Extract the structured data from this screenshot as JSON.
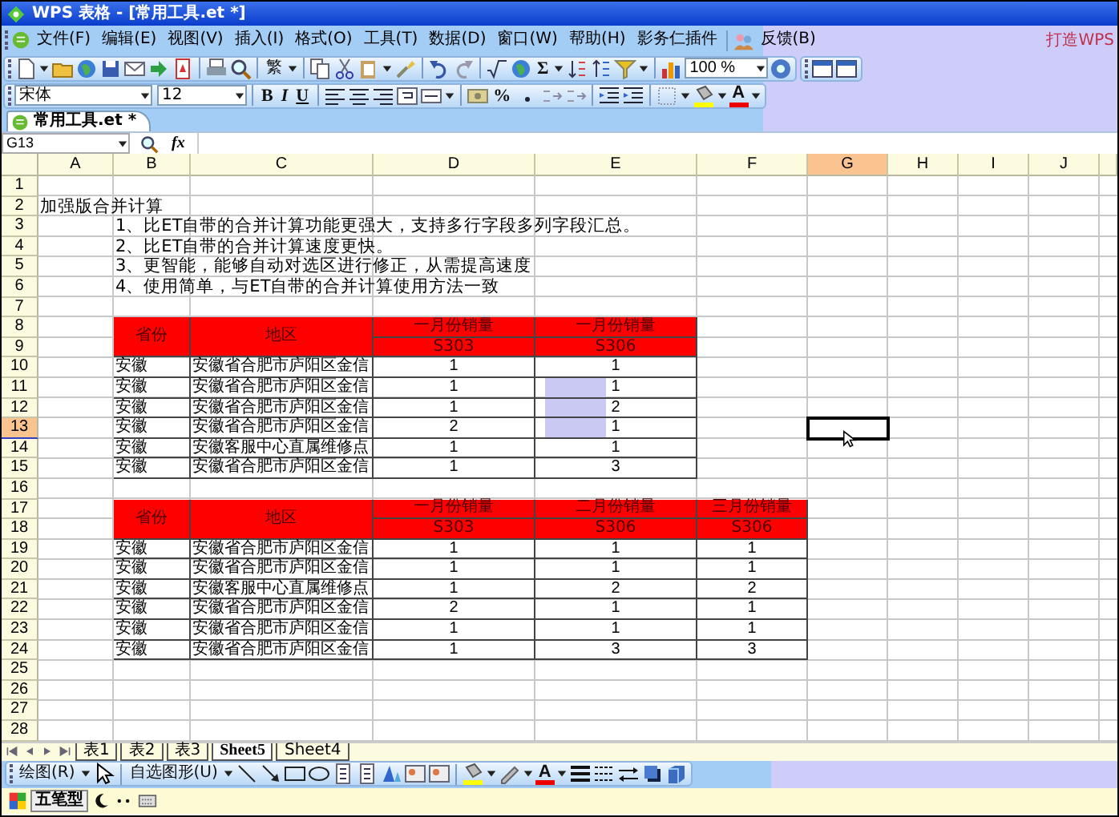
{
  "window": {
    "title": "WPS 表格 - [常用工具.et *]",
    "banner": "打造WPS"
  },
  "menu": [
    "文件(F)",
    "编辑(E)",
    "视图(V)",
    "插入(I)",
    "格式(O)",
    "工具(T)",
    "数据(D)",
    "窗口(W)",
    "帮助(H)",
    "影务仁插件",
    "反馈(B)"
  ],
  "standard_toolbar": {
    "traditional": "繁",
    "sum": "Σ",
    "zoom": "100 %"
  },
  "format_toolbar": {
    "font": "宋体",
    "size": "12",
    "bold": "B",
    "italic": "I",
    "underline": "U",
    "percent": "%",
    "font_color": "A"
  },
  "document_tabs": [
    {
      "label": "常用工具.et *",
      "selected": true
    }
  ],
  "formula_bar": {
    "name_box": "G13",
    "function_label": "fx"
  },
  "columns": [
    {
      "label": "A",
      "selected": false
    },
    {
      "label": "B",
      "selected": false
    },
    {
      "label": "C",
      "selected": false
    },
    {
      "label": "D",
      "selected": false
    },
    {
      "label": "E",
      "selected": false
    },
    {
      "label": "F",
      "selected": false
    },
    {
      "label": "G",
      "selected": true
    },
    {
      "label": "H",
      "selected": false
    },
    {
      "label": "I",
      "selected": false
    },
    {
      "label": "J",
      "selected": false
    }
  ],
  "rows": [
    {
      "header": "1",
      "selected": false
    },
    {
      "header": "2",
      "selected": false,
      "cells": [
        {
          "text": "加强版合并计算",
          "kind": "note"
        }
      ]
    },
    {
      "header": "3",
      "selected": false,
      "cells": [
        null,
        {
          "text": "1、比ET自带的合并计算功能更强大，支持多行字段多列字段汇总。",
          "kind": "note"
        }
      ]
    },
    {
      "header": "4",
      "selected": false,
      "cells": [
        null,
        {
          "text": "2、比ET自带的合并计算速度更快。",
          "kind": "note"
        }
      ]
    },
    {
      "header": "5",
      "selected": false,
      "cells": [
        null,
        {
          "text": "3、更智能，能够自动对选区进行修正，从需提高速度",
          "kind": "note"
        }
      ]
    },
    {
      "header": "6",
      "selected": false,
      "cells": [
        null,
        {
          "text": "4、使用简单，与ET自带的合并计算使用方法一致",
          "kind": "note"
        }
      ]
    },
    {
      "header": "7",
      "selected": false
    },
    {
      "header": "8",
      "selected": false,
      "cells": [
        null,
        {
          "text": "省份",
          "kind": "head",
          "merged_down": true
        },
        {
          "text": "地区",
          "kind": "head",
          "merged_down": true
        },
        {
          "text": "一月份销量",
          "kind": "head"
        },
        {
          "text": "一月份销量",
          "kind": "head"
        }
      ]
    },
    {
      "header": "9",
      "selected": false,
      "cells": [
        null,
        null,
        null,
        {
          "text": "S303",
          "kind": "head"
        },
        {
          "text": "S306",
          "kind": "head"
        }
      ]
    },
    {
      "header": "10",
      "selected": false,
      "cells": [
        null,
        {
          "text": "安徽",
          "kind": "text"
        },
        {
          "text": "安徽省合肥市庐阳区金信",
          "kind": "text"
        },
        {
          "text": "1",
          "kind": "number"
        },
        {
          "text": "1",
          "kind": "number"
        }
      ]
    },
    {
      "header": "11",
      "selected": false,
      "cells": [
        null,
        {
          "text": "安徽",
          "kind": "text"
        },
        {
          "text": "安徽省合肥市庐阳区金信",
          "kind": "text"
        },
        {
          "text": "1",
          "kind": "number"
        },
        {
          "text": "1",
          "kind": "number"
        }
      ]
    },
    {
      "header": "12",
      "selected": false,
      "cells": [
        null,
        {
          "text": "安徽",
          "kind": "text"
        },
        {
          "text": "安徽省合肥市庐阳区金信",
          "kind": "text"
        },
        {
          "text": "1",
          "kind": "number"
        },
        {
          "text": "2",
          "kind": "number"
        }
      ]
    },
    {
      "header": "13",
      "selected": true,
      "cells": [
        null,
        {
          "text": "安徽",
          "kind": "text"
        },
        {
          "text": "安徽省合肥市庐阳区金信",
          "kind": "text"
        },
        {
          "text": "2",
          "kind": "number"
        },
        {
          "text": "1",
          "kind": "number"
        }
      ]
    },
    {
      "header": "14",
      "selected": false,
      "cells": [
        null,
        {
          "text": "安徽",
          "kind": "text"
        },
        {
          "text": "安徽客服中心直属维修点",
          "kind": "text"
        },
        {
          "text": "1",
          "kind": "number"
        },
        {
          "text": "1",
          "kind": "number"
        }
      ]
    },
    {
      "header": "15",
      "selected": false,
      "cells": [
        null,
        {
          "text": "安徽",
          "kind": "text"
        },
        {
          "text": "安徽省合肥市庐阳区金信",
          "kind": "text"
        },
        {
          "text": "1",
          "kind": "number"
        },
        {
          "text": "3",
          "kind": "number"
        }
      ]
    },
    {
      "header": "16",
      "selected": false
    },
    {
      "header": "17",
      "selected": false,
      "cells": [
        null,
        {
          "text": "省份",
          "kind": "head",
          "merged_down": true
        },
        {
          "text": "地区",
          "kind": "head",
          "merged_down": true
        },
        {
          "text": "一月份销量",
          "kind": "head"
        },
        {
          "text": "二月份销量",
          "kind": "head"
        },
        {
          "text": "三月份销量",
          "kind": "head"
        }
      ]
    },
    {
      "header": "18",
      "selected": false,
      "cells": [
        null,
        null,
        null,
        {
          "text": "S303",
          "kind": "head"
        },
        {
          "text": "S306",
          "kind": "head"
        },
        {
          "text": "S306",
          "kind": "head"
        }
      ]
    },
    {
      "header": "19",
      "selected": false,
      "cells": [
        null,
        {
          "text": "安徽",
          "kind": "text"
        },
        {
          "text": "安徽省合肥市庐阳区金信",
          "kind": "text"
        },
        {
          "text": "1",
          "kind": "number"
        },
        {
          "text": "1",
          "kind": "number"
        },
        {
          "text": "1",
          "kind": "number"
        }
      ]
    },
    {
      "header": "20",
      "selected": false,
      "cells": [
        null,
        {
          "text": "安徽",
          "kind": "text"
        },
        {
          "text": "安徽省合肥市庐阳区金信",
          "kind": "text"
        },
        {
          "text": "1",
          "kind": "number"
        },
        {
          "text": "1",
          "kind": "number"
        },
        {
          "text": "1",
          "kind": "number"
        }
      ]
    },
    {
      "header": "21",
      "selected": false,
      "cells": [
        null,
        {
          "text": "安徽",
          "kind": "text"
        },
        {
          "text": "安徽客服中心直属维修点",
          "kind": "text"
        },
        {
          "text": "1",
          "kind": "number"
        },
        {
          "text": "2",
          "kind": "number"
        },
        {
          "text": "2",
          "kind": "number"
        }
      ]
    },
    {
      "header": "22",
      "selected": false,
      "cells": [
        null,
        {
          "text": "安徽",
          "kind": "text"
        },
        {
          "text": "安徽省合肥市庐阳区金信",
          "kind": "text"
        },
        {
          "text": "2",
          "kind": "number"
        },
        {
          "text": "1",
          "kind": "number"
        },
        {
          "text": "1",
          "kind": "number"
        }
      ]
    },
    {
      "header": "23",
      "selected": false,
      "cells": [
        null,
        {
          "text": "安徽",
          "kind": "text"
        },
        {
          "text": "安徽省合肥市庐阳区金信",
          "kind": "text"
        },
        {
          "text": "1",
          "kind": "number"
        },
        {
          "text": "1",
          "kind": "number"
        },
        {
          "text": "1",
          "kind": "number"
        }
      ]
    },
    {
      "header": "24",
      "selected": false,
      "cells": [
        null,
        {
          "text": "安徽",
          "kind": "text"
        },
        {
          "text": "安徽省合肥市庐阳区金信",
          "kind": "text"
        },
        {
          "text": "1",
          "kind": "number"
        },
        {
          "text": "3",
          "kind": "number"
        },
        {
          "text": "3",
          "kind": "number"
        }
      ]
    },
    {
      "header": "25",
      "selected": false
    },
    {
      "header": "26",
      "selected": false
    },
    {
      "header": "27",
      "selected": false
    },
    {
      "header": "28",
      "selected": false
    }
  ],
  "sheet_tabs": [
    {
      "label": "表1",
      "selected": false
    },
    {
      "label": "表2",
      "selected": false
    },
    {
      "label": "表3",
      "selected": false
    },
    {
      "label": "Sheet5",
      "selected": true
    },
    {
      "label": "Sheet4",
      "selected": false
    }
  ],
  "drawing_toolbar": {
    "draw": "绘图(R)",
    "autoshapes": "自选图形(U)",
    "font_color": "A"
  },
  "ime_bar": {
    "mode": "五笔型"
  }
}
